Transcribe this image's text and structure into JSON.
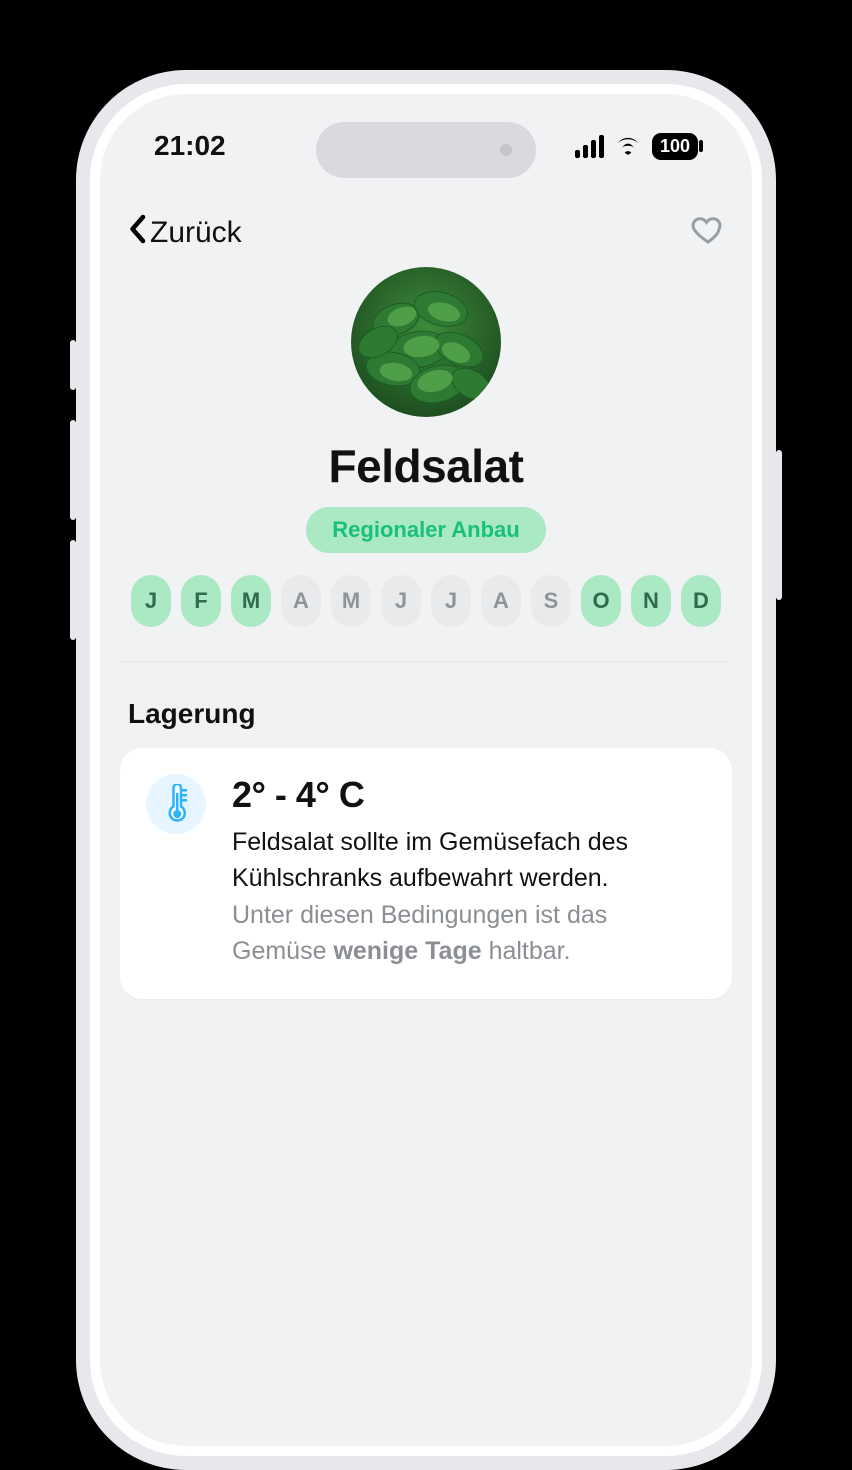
{
  "status": {
    "time": "21:02",
    "battery": "100"
  },
  "nav": {
    "back_label": "Zurück"
  },
  "hero": {
    "title": "Feldsalat",
    "tag": "Regionaler Anbau"
  },
  "months": [
    {
      "label": "J",
      "active": true
    },
    {
      "label": "F",
      "active": true
    },
    {
      "label": "M",
      "active": true
    },
    {
      "label": "A",
      "active": false
    },
    {
      "label": "M",
      "active": false
    },
    {
      "label": "J",
      "active": false
    },
    {
      "label": "J",
      "active": false
    },
    {
      "label": "A",
      "active": false
    },
    {
      "label": "S",
      "active": false
    },
    {
      "label": "O",
      "active": true
    },
    {
      "label": "N",
      "active": true
    },
    {
      "label": "D",
      "active": true
    }
  ],
  "storage": {
    "section_title": "Lagerung",
    "temperature": "2° - 4° C",
    "primary": "Feldsalat sollte im Gemüsefach des Kühlschranks aufbewahrt werden.",
    "secondary_pre": "Unter diesen Bedingungen ist das Gemüse ",
    "secondary_bold": "wenige Tage",
    "secondary_post": " haltbar."
  }
}
